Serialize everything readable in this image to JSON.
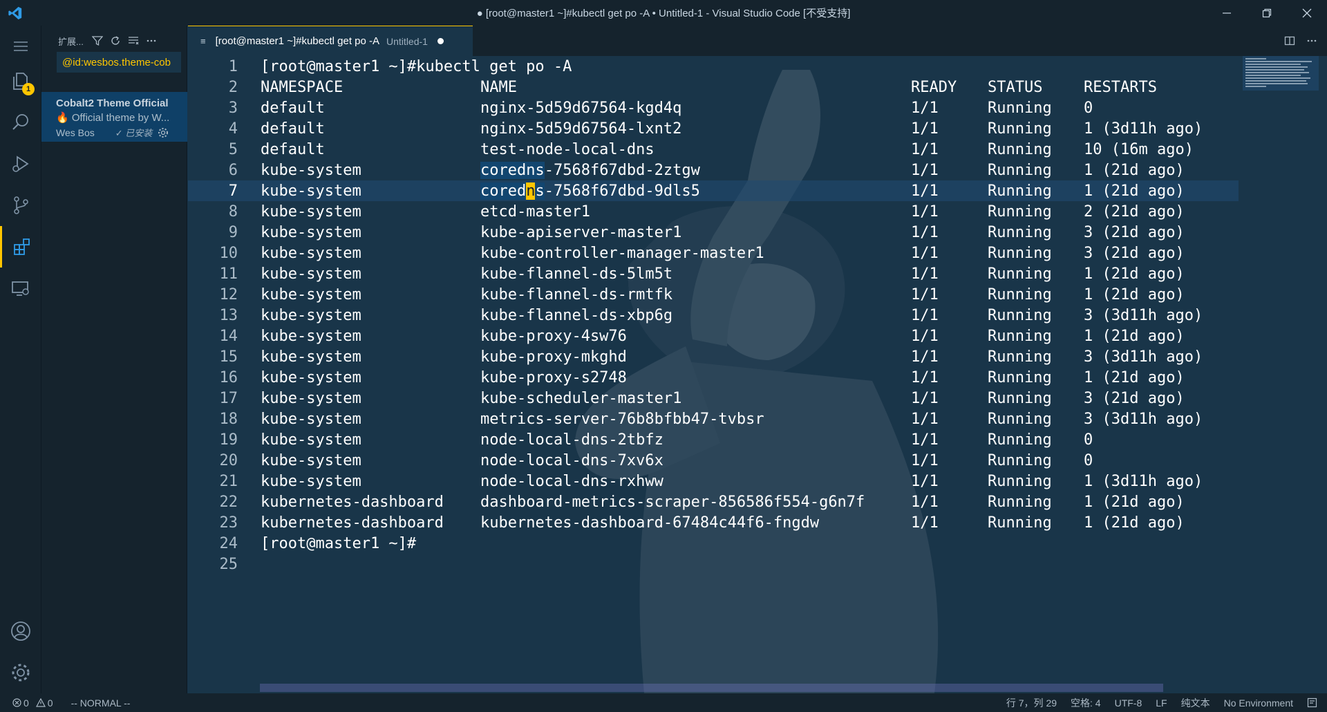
{
  "window": {
    "title": "● [root@master1 ~]#kubectl get po -A • Untitled-1 - Visual Studio Code [不受支持]"
  },
  "activity": {
    "explorer_badge": "1"
  },
  "sidebar": {
    "header_title": "扩展...",
    "search_value": "@id:wesbos.theme-cob",
    "extension": {
      "name": "Cobalt2 Theme Official",
      "description": "Official theme by W...",
      "publisher": "Wes Bos",
      "installed": "✓ 已安装"
    }
  },
  "tab": {
    "label": "[root@master1 ~]#kubectl get po -A",
    "description": "Untitled-1"
  },
  "editor": {
    "command_line": "[root@master1 ~]#kubectl get po -A",
    "header": [
      "NAMESPACE",
      "NAME",
      "READY",
      "STATUS",
      "RESTARTS"
    ],
    "rows": [
      [
        "default",
        "nginx-5d59d67564-kgd4q",
        "1/1",
        "Running",
        "0"
      ],
      [
        "default",
        "nginx-5d59d67564-lxnt2",
        "1/1",
        "Running",
        "1 (3d11h ago)"
      ],
      [
        "default",
        "test-node-local-dns",
        "1/1",
        "Running",
        "10 (16m ago)"
      ],
      [
        "kube-system",
        "coredns-7568f67dbd-2ztgw",
        "1/1",
        "Running",
        "1 (21d ago)"
      ],
      [
        "kube-system",
        "coredns-7568f67dbd-9dls5",
        "1/1",
        "Running",
        "1 (21d ago)"
      ],
      [
        "kube-system",
        "etcd-master1",
        "1/1",
        "Running",
        "2 (21d ago)"
      ],
      [
        "kube-system",
        "kube-apiserver-master1",
        "1/1",
        "Running",
        "3 (21d ago)"
      ],
      [
        "kube-system",
        "kube-controller-manager-master1",
        "1/1",
        "Running",
        "3 (21d ago)"
      ],
      [
        "kube-system",
        "kube-flannel-ds-5lm5t",
        "1/1",
        "Running",
        "1 (21d ago)"
      ],
      [
        "kube-system",
        "kube-flannel-ds-rmtfk",
        "1/1",
        "Running",
        "1 (21d ago)"
      ],
      [
        "kube-system",
        "kube-flannel-ds-xbp6g",
        "1/1",
        "Running",
        "3 (3d11h ago)"
      ],
      [
        "kube-system",
        "kube-proxy-4sw76",
        "1/1",
        "Running",
        "1 (21d ago)"
      ],
      [
        "kube-system",
        "kube-proxy-mkghd",
        "1/1",
        "Running",
        "3 (3d11h ago)"
      ],
      [
        "kube-system",
        "kube-proxy-s2748",
        "1/1",
        "Running",
        "1 (21d ago)"
      ],
      [
        "kube-system",
        "kube-scheduler-master1",
        "1/1",
        "Running",
        "3 (21d ago)"
      ],
      [
        "kube-system",
        "metrics-server-76b8bfbb47-tvbsr",
        "1/1",
        "Running",
        "3 (3d11h ago)"
      ],
      [
        "kube-system",
        "node-local-dns-2tbfz",
        "1/1",
        "Running",
        "0"
      ],
      [
        "kube-system",
        "node-local-dns-7xv6x",
        "1/1",
        "Running",
        "0"
      ],
      [
        "kube-system",
        "node-local-dns-rxhww",
        "1/1",
        "Running",
        "1 (3d11h ago)"
      ],
      [
        "kubernetes-dashboard",
        "dashboard-metrics-scraper-856586f554-g6n7f",
        "1/1",
        "Running",
        "1 (21d ago)"
      ],
      [
        "kubernetes-dashboard",
        "kubernetes-dashboard-67484c44f6-fngdw",
        "1/1",
        "Running",
        "1 (21d ago)"
      ]
    ],
    "prompt_line": "[root@master1 ~]#",
    "current_line": 7
  },
  "statusbar": {
    "errors": "0",
    "warnings": "0",
    "mode": "-- NORMAL --",
    "position": "行 7，列 29",
    "spaces": "空格: 4",
    "encoding": "UTF-8",
    "eol": "LF",
    "language": "纯文本",
    "environment": "No Environment"
  },
  "colors": {
    "background": "#193549",
    "chrome": "#15232d",
    "accent": "#ffc600",
    "selection": "#0f4067"
  }
}
